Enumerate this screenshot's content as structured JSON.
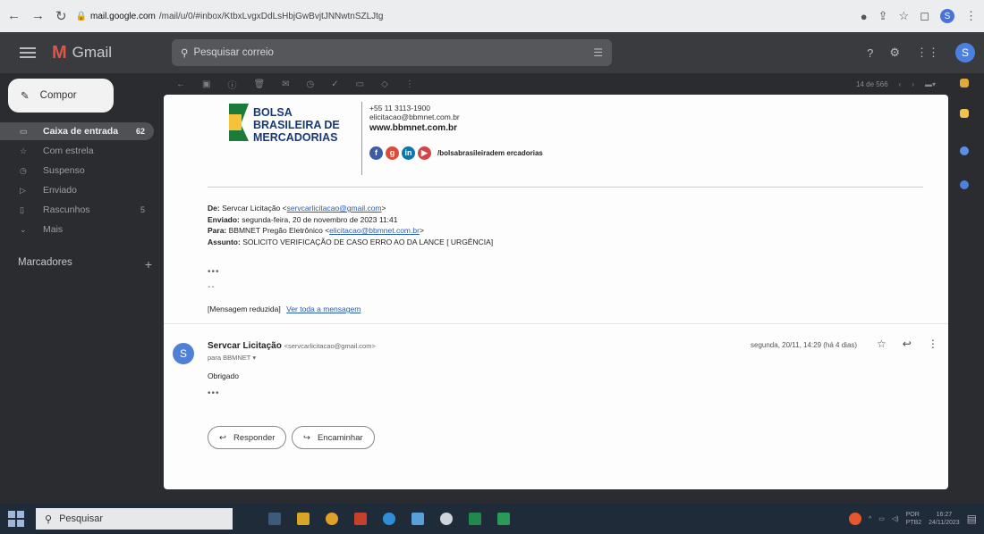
{
  "browser": {
    "url_domain": "mail.google.com",
    "url_path": "/mail/u/0/#inbox/KtbxLvgxDdLsHbjGwBvjtJNNwtnSZLJtg",
    "profile_initial": "S"
  },
  "gmail": {
    "app_name": "Gmail",
    "search_placeholder": "Pesquisar correio",
    "user_initial": "S"
  },
  "sidebar": {
    "compose_label": "Compor",
    "items": [
      {
        "label": "Caixa de entrada",
        "count": "62"
      },
      {
        "label": "Com estrela",
        "count": ""
      },
      {
        "label": "Suspenso",
        "count": ""
      },
      {
        "label": "Enviado",
        "count": ""
      },
      {
        "label": "Rascunhos",
        "count": "5"
      },
      {
        "label": "Mais",
        "count": ""
      }
    ],
    "labels_title": "Marcadores",
    "labels_plus": "+"
  },
  "toolbar": {
    "pager": "14 de 566"
  },
  "signature": {
    "company_line1": "BOLSA",
    "company_line2": "BRASILEIRA DE",
    "company_line3": "MERCADORIAS",
    "phone": "+55 11 3113-1900",
    "email": "elicitacao@bbmnet.com.br",
    "website": "www.bbmnet.com.br",
    "social_handle": "/bolsabrasileiradem ercadorias"
  },
  "quoted": {
    "from_label": "De:",
    "from_name": "Servcar Licitação",
    "from_email": "servcarlicitacao@gmail.com",
    "sent_label": "Enviado:",
    "sent_value": "segunda-feira, 20 de novembro de 2023 11:41",
    "to_label": "Para:",
    "to_name": "BBMNET Pregão Eletrônico",
    "to_email": "elicitacao@bbmnet.com.br",
    "subject_label": "Assunto:",
    "subject_value": "SOLICITO VERIFICAÇÃO DE CASO ERRO AO DA LANCE [ URGÊNCIA]",
    "dots": "•••",
    "dash": "--",
    "reduced_text": "[Mensagem reduzida]",
    "view_full": "Ver toda a mensagem"
  },
  "message": {
    "avatar_initial": "S",
    "sender_name": "Servcar Licitação",
    "sender_email": "<servcarlicitacao@gmail.com>",
    "to_line": "para BBMNET",
    "body": "Obrigado",
    "dots": "•••",
    "timestamp": "segunda, 20/11, 14:29 (há 4 dias)"
  },
  "actions": {
    "reply": "Responder",
    "forward": "Encaminhar"
  },
  "taskbar": {
    "search_label": "Pesquisar",
    "lang": "POR",
    "lang2": "PTB2",
    "time": "16:27",
    "date": "24/11/2023"
  }
}
